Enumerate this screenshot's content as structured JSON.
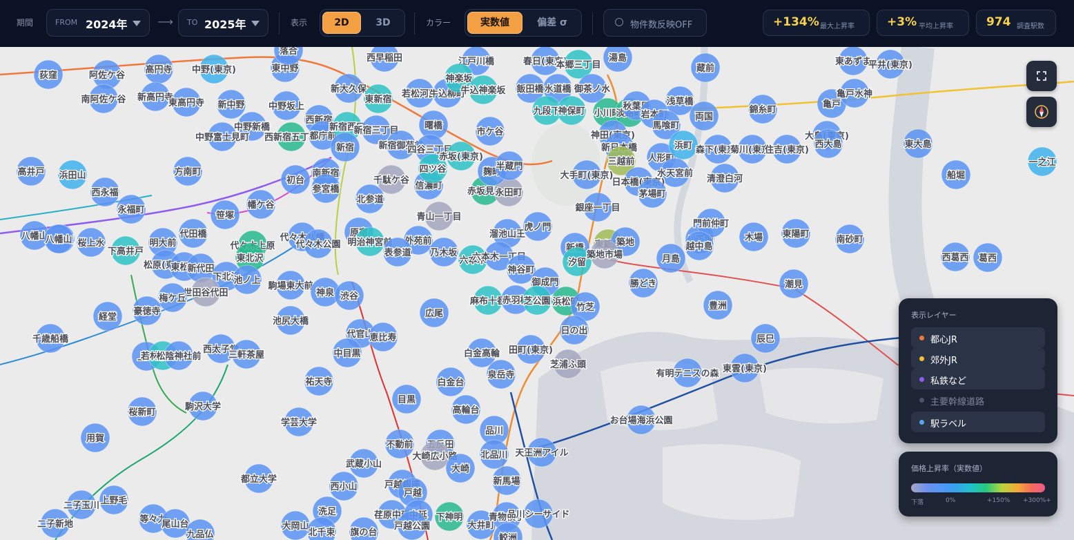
{
  "toolbar": {
    "period_label": "期間",
    "from": {
      "prefix": "FROM",
      "value": "2024年"
    },
    "arrow": "⟶",
    "to": {
      "prefix": "TO",
      "value": "2025年"
    },
    "display_label": "表示",
    "view_options": [
      "2D",
      "3D"
    ],
    "view_selected": "2D",
    "color_label": "カラー",
    "color_options": [
      "実数値",
      "偏差 σ"
    ],
    "color_selected": "実数値",
    "property_toggle": "物件数反映OFF",
    "stats": [
      {
        "value": "+134%",
        "label": "最大上昇率"
      },
      {
        "value": "+3%",
        "label": "平均上昇率"
      },
      {
        "value": "974",
        "label": "調査駅数"
      }
    ]
  },
  "map_controls": {
    "fullscreen_icon": "fullscreen-icon",
    "compass_icon": "compass-icon"
  },
  "layers": {
    "title": "表示レイヤー",
    "items": [
      {
        "label": "都心JR",
        "color": "#f0783a",
        "on": true
      },
      {
        "label": "郊外JR",
        "color": "#f2c230",
        "on": true
      },
      {
        "label": "私鉄など",
        "color": "#8f5cf0",
        "on": true
      },
      {
        "label": "主要幹線道路",
        "color": "#4b5468",
        "on": false
      },
      {
        "label": "駅ラベル",
        "color": "#5da2f5",
        "on": true
      }
    ]
  },
  "legend": {
    "title": "価格上昇率（実数値）",
    "ticks": [
      "下落",
      "0%",
      "+150%",
      "+300%+"
    ]
  },
  "colors": {
    "blue": "#5b93f2",
    "lightblue": "#3fb1ec",
    "cyan": "#2ec2c6",
    "teal": "#27b88e",
    "olive": "#9dbb55",
    "gray": "#a3a6bf"
  },
  "stations": [
    {
      "name": "荻窪",
      "c": "blue"
    },
    {
      "name": "阿佐ケ谷",
      "c": "blue"
    },
    {
      "name": "高円寺",
      "c": "blue"
    },
    {
      "name": "中野(東京)",
      "c": "lightblue"
    },
    {
      "name": "東中野",
      "c": "blue"
    },
    {
      "name": "落合",
      "c": "blue"
    },
    {
      "name": "南阿佐ケ谷",
      "c": "blue"
    },
    {
      "name": "新高円寺",
      "c": "blue"
    },
    {
      "name": "東高円寺",
      "c": "blue"
    },
    {
      "name": "新中野",
      "c": "blue"
    },
    {
      "name": "中野坂上",
      "c": "blue"
    },
    {
      "name": "西新宿",
      "c": "blue"
    },
    {
      "name": "中野新橋",
      "c": "blue"
    },
    {
      "name": "中野富士見町",
      "c": "blue"
    },
    {
      "name": "西新宿五丁目",
      "c": "teal"
    },
    {
      "name": "都庁前",
      "c": "blue"
    },
    {
      "name": "新大久保",
      "c": "blue"
    },
    {
      "name": "東新宿",
      "c": "cyan"
    },
    {
      "name": "新宿西口",
      "c": "cyan"
    },
    {
      "name": "新宿三丁目",
      "c": "blue"
    },
    {
      "name": "新宿",
      "c": "blue"
    },
    {
      "name": "西早稲田",
      "c": "blue"
    },
    {
      "name": "若松河田",
      "c": "blue"
    },
    {
      "name": "牛込柳町",
      "c": "blue"
    },
    {
      "name": "新宿御苑前",
      "c": "blue"
    },
    {
      "name": "曙橋",
      "c": "blue"
    },
    {
      "name": "四谷三丁目",
      "c": "blue"
    },
    {
      "name": "市ケ谷",
      "c": "blue"
    },
    {
      "name": "江戸川橋",
      "c": "blue"
    },
    {
      "name": "神楽坂",
      "c": "cyan"
    },
    {
      "name": "牛込神楽坂",
      "c": "cyan"
    },
    {
      "name": "飯田橋",
      "c": "blue"
    },
    {
      "name": "春日(東京)",
      "c": "blue"
    },
    {
      "name": "本郷三丁目",
      "c": "cyan"
    },
    {
      "name": "水道橋",
      "c": "blue"
    },
    {
      "name": "御茶ノ水",
      "c": "blue"
    },
    {
      "name": "湯島",
      "c": "blue"
    },
    {
      "name": "九段下",
      "c": "cyan"
    },
    {
      "name": "神保町",
      "c": "cyan"
    },
    {
      "name": "小川町",
      "c": "teal"
    },
    {
      "name": "淡路町",
      "c": "teal"
    },
    {
      "name": "秋葉原",
      "c": "blue"
    },
    {
      "name": "岩本町",
      "c": "blue"
    },
    {
      "name": "浅草橋",
      "c": "blue"
    },
    {
      "name": "馬喰町",
      "c": "blue"
    },
    {
      "name": "両国",
      "c": "blue"
    },
    {
      "name": "蔵前",
      "c": "blue"
    },
    {
      "name": "錦糸町",
      "c": "blue"
    },
    {
      "name": "亀戸",
      "c": "blue"
    },
    {
      "name": "亀戸水神",
      "c": "blue"
    },
    {
      "name": "東あずま",
      "c": "blue"
    },
    {
      "name": "平井(東京)",
      "c": "blue"
    },
    {
      "name": "大島(東京)",
      "c": "blue"
    },
    {
      "name": "西大島",
      "c": "blue"
    },
    {
      "name": "東大島",
      "c": "blue"
    },
    {
      "name": "一之江",
      "c": "lightblue"
    },
    {
      "name": "船堀",
      "c": "blue"
    },
    {
      "name": "神田(東京)",
      "c": "blue"
    },
    {
      "name": "新日本橋",
      "c": "blue"
    },
    {
      "name": "三越前",
      "c": "olive"
    },
    {
      "name": "人形町",
      "c": "blue"
    },
    {
      "name": "浜町",
      "c": "lightblue"
    },
    {
      "name": "森下(東京)",
      "c": "blue"
    },
    {
      "name": "菊川(東京)",
      "c": "blue"
    },
    {
      "name": "住吉(東京)",
      "c": "blue"
    },
    {
      "name": "水天宮前",
      "c": "blue"
    },
    {
      "name": "清澄白河",
      "c": "blue"
    },
    {
      "name": "日本橋(東京)",
      "c": "blue"
    },
    {
      "name": "茅場町",
      "c": "blue"
    },
    {
      "name": "大手町(東京)",
      "c": "blue"
    },
    {
      "name": "高井戸",
      "c": "blue"
    },
    {
      "name": "浜田山",
      "c": "lightblue"
    },
    {
      "name": "西永福",
      "c": "blue"
    },
    {
      "name": "永福町",
      "c": "blue"
    },
    {
      "name": "方南町",
      "c": "blue"
    },
    {
      "name": "初台",
      "c": "blue"
    },
    {
      "name": "南新宿",
      "c": "blue"
    },
    {
      "name": "参宮橋",
      "c": "blue"
    },
    {
      "name": "千駄ケ谷",
      "c": "gray"
    },
    {
      "name": "北参道",
      "c": "blue"
    },
    {
      "name": "信濃町",
      "c": "blue"
    },
    {
      "name": "四ツ谷",
      "c": "cyan"
    },
    {
      "name": "赤坂見附",
      "c": "teal"
    },
    {
      "name": "溜池山王",
      "c": "blue"
    },
    {
      "name": "永田町",
      "c": "gray"
    },
    {
      "name": "麹町",
      "c": "blue"
    },
    {
      "name": "半蔵門",
      "c": "blue"
    },
    {
      "name": "赤坂(東京)",
      "c": "cyan"
    },
    {
      "name": "幡ケ谷",
      "c": "blue"
    },
    {
      "name": "笹塚",
      "c": "blue"
    },
    {
      "name": "代田橋",
      "c": "blue"
    },
    {
      "name": "八幡山",
      "c": "blue"
    },
    {
      "name": "上北沢",
      "c": "blue"
    },
    {
      "name": "桜上水",
      "c": "blue"
    },
    {
      "name": "下高井戸",
      "c": "cyan"
    },
    {
      "name": "明大前",
      "c": "blue"
    },
    {
      "name": "代々木上原",
      "c": "teal"
    },
    {
      "name": "代々木八幡",
      "c": "blue"
    },
    {
      "name": "代々木公園",
      "c": "blue"
    },
    {
      "name": "東北沢",
      "c": "teal"
    },
    {
      "name": "原宿",
      "c": "blue"
    },
    {
      "name": "明治神宮前",
      "c": "cyan"
    },
    {
      "name": "外苑前",
      "c": "blue"
    },
    {
      "name": "青山一丁目",
      "c": "gray"
    },
    {
      "name": "表参道",
      "c": "blue"
    },
    {
      "name": "乃木坂",
      "c": "blue"
    },
    {
      "name": "六本木",
      "c": "cyan"
    },
    {
      "name": "六本木一丁目",
      "c": "blue"
    },
    {
      "name": "虎ノ門",
      "c": "blue"
    },
    {
      "name": "神谷町",
      "c": "blue"
    },
    {
      "name": "御成門",
      "c": "blue"
    },
    {
      "name": "銀座一丁目",
      "c": "blue"
    },
    {
      "name": "東銀座",
      "c": "olive"
    },
    {
      "name": "築地",
      "c": "blue"
    },
    {
      "name": "新橋",
      "c": "blue"
    },
    {
      "name": "汐留",
      "c": "cyan"
    },
    {
      "name": "築地市場",
      "c": "gray"
    },
    {
      "name": "八丁堀",
      "c": "blue"
    },
    {
      "name": "門前仲町",
      "c": "blue"
    },
    {
      "name": "越中島",
      "c": "blue"
    },
    {
      "name": "木場",
      "c": "blue"
    },
    {
      "name": "東陽町",
      "c": "blue"
    },
    {
      "name": "南砂町",
      "c": "blue"
    },
    {
      "name": "西葛西",
      "c": "blue"
    },
    {
      "name": "葛西",
      "c": "blue"
    },
    {
      "name": "月島",
      "c": "blue"
    },
    {
      "name": "勝どき",
      "c": "blue"
    },
    {
      "name": "潮見",
      "c": "blue"
    },
    {
      "name": "豊洲",
      "c": "blue"
    },
    {
      "name": "辰巳",
      "c": "blue"
    },
    {
      "name": "松原(東京)",
      "c": "blue"
    },
    {
      "name": "東松原",
      "c": "blue"
    },
    {
      "name": "新代田",
      "c": "blue"
    },
    {
      "name": "下北沢",
      "c": "blue"
    },
    {
      "name": "池ノ上",
      "c": "blue"
    },
    {
      "name": "世田谷代田",
      "c": "gray"
    },
    {
      "name": "駒場東大前",
      "c": "blue"
    },
    {
      "name": "神泉",
      "c": "blue"
    },
    {
      "name": "渋谷",
      "c": "blue"
    },
    {
      "name": "梅ケ丘",
      "c": "blue"
    },
    {
      "name": "豪徳寺",
      "c": "blue"
    },
    {
      "name": "経堂",
      "c": "blue"
    },
    {
      "name": "千歳船橋",
      "c": "blue"
    },
    {
      "name": "池尻大橋",
      "c": "blue"
    },
    {
      "name": "広尾",
      "c": "blue"
    },
    {
      "name": "麻布十番",
      "c": "cyan"
    },
    {
      "name": "赤羽橋",
      "c": "blue"
    },
    {
      "name": "芝公園",
      "c": "cyan"
    },
    {
      "name": "浜松町",
      "c": "teal"
    },
    {
      "name": "竹芝",
      "c": "blue"
    },
    {
      "name": "日の出",
      "c": "blue"
    },
    {
      "name": "上町",
      "c": "blue"
    },
    {
      "name": "若林(東京)",
      "c": "cyan"
    },
    {
      "name": "松陰神社前",
      "c": "blue"
    },
    {
      "name": "西太子堂",
      "c": "blue"
    },
    {
      "name": "三軒茶屋",
      "c": "blue"
    },
    {
      "name": "代官山",
      "c": "blue"
    },
    {
      "name": "恵比寿",
      "c": "blue"
    },
    {
      "name": "中目黒",
      "c": "blue"
    },
    {
      "name": "祐天寺",
      "c": "blue"
    },
    {
      "name": "白金高輪",
      "c": "blue"
    },
    {
      "name": "田町(東京)",
      "c": "blue"
    },
    {
      "name": "芝浦ふ頭",
      "c": "gray"
    },
    {
      "name": "泉岳寺",
      "c": "blue"
    },
    {
      "name": "白金台",
      "c": "blue"
    },
    {
      "name": "目黒",
      "c": "blue"
    },
    {
      "name": "有明テニスの森",
      "c": "blue"
    },
    {
      "name": "東雲(東京)",
      "c": "blue"
    },
    {
      "name": "駒沢大学",
      "c": "blue"
    },
    {
      "name": "桜新町",
      "c": "blue"
    },
    {
      "name": "学芸大学",
      "c": "blue"
    },
    {
      "name": "用賀",
      "c": "blue"
    },
    {
      "name": "高輪台",
      "c": "blue"
    },
    {
      "name": "品川",
      "c": "blue"
    },
    {
      "name": "お台場海浜公園",
      "c": "blue"
    },
    {
      "name": "不動前",
      "c": "blue"
    },
    {
      "name": "五反田",
      "c": "blue"
    },
    {
      "name": "大崎広小路",
      "c": "gray"
    },
    {
      "name": "大崎",
      "c": "blue"
    },
    {
      "name": "北品川",
      "c": "blue"
    },
    {
      "name": "天王洲アイル",
      "c": "blue"
    },
    {
      "name": "武蔵小山",
      "c": "blue"
    },
    {
      "name": "西小山",
      "c": "blue"
    },
    {
      "name": "戸越銀座",
      "c": "blue"
    },
    {
      "name": "戸越",
      "c": "blue"
    },
    {
      "name": "都立大学",
      "c": "blue"
    },
    {
      "name": "二子玉川",
      "c": "blue"
    },
    {
      "name": "上野毛",
      "c": "blue"
    },
    {
      "name": "等々力",
      "c": "blue"
    },
    {
      "name": "尾山台",
      "c": "blue"
    },
    {
      "name": "九品仏",
      "c": "blue"
    },
    {
      "name": "二子新地",
      "c": "blue"
    },
    {
      "name": "洗足",
      "c": "blue"
    },
    {
      "name": "大岡山",
      "c": "blue"
    },
    {
      "name": "荏原中延",
      "c": "blue"
    },
    {
      "name": "中延",
      "c": "blue"
    },
    {
      "name": "戸越公園",
      "c": "blue"
    },
    {
      "name": "下神明",
      "c": "teal"
    },
    {
      "name": "大井町",
      "c": "blue"
    },
    {
      "name": "新馬場",
      "c": "blue"
    },
    {
      "name": "青物横丁",
      "c": "blue"
    },
    {
      "name": "品川シーサイド",
      "c": "blue"
    },
    {
      "name": "北千束",
      "c": "blue"
    },
    {
      "name": "旗の台",
      "c": "blue"
    },
    {
      "name": "鮫洲",
      "c": "blue"
    },
    {
      "name": "八幡山",
      "c": "blue"
    }
  ]
}
